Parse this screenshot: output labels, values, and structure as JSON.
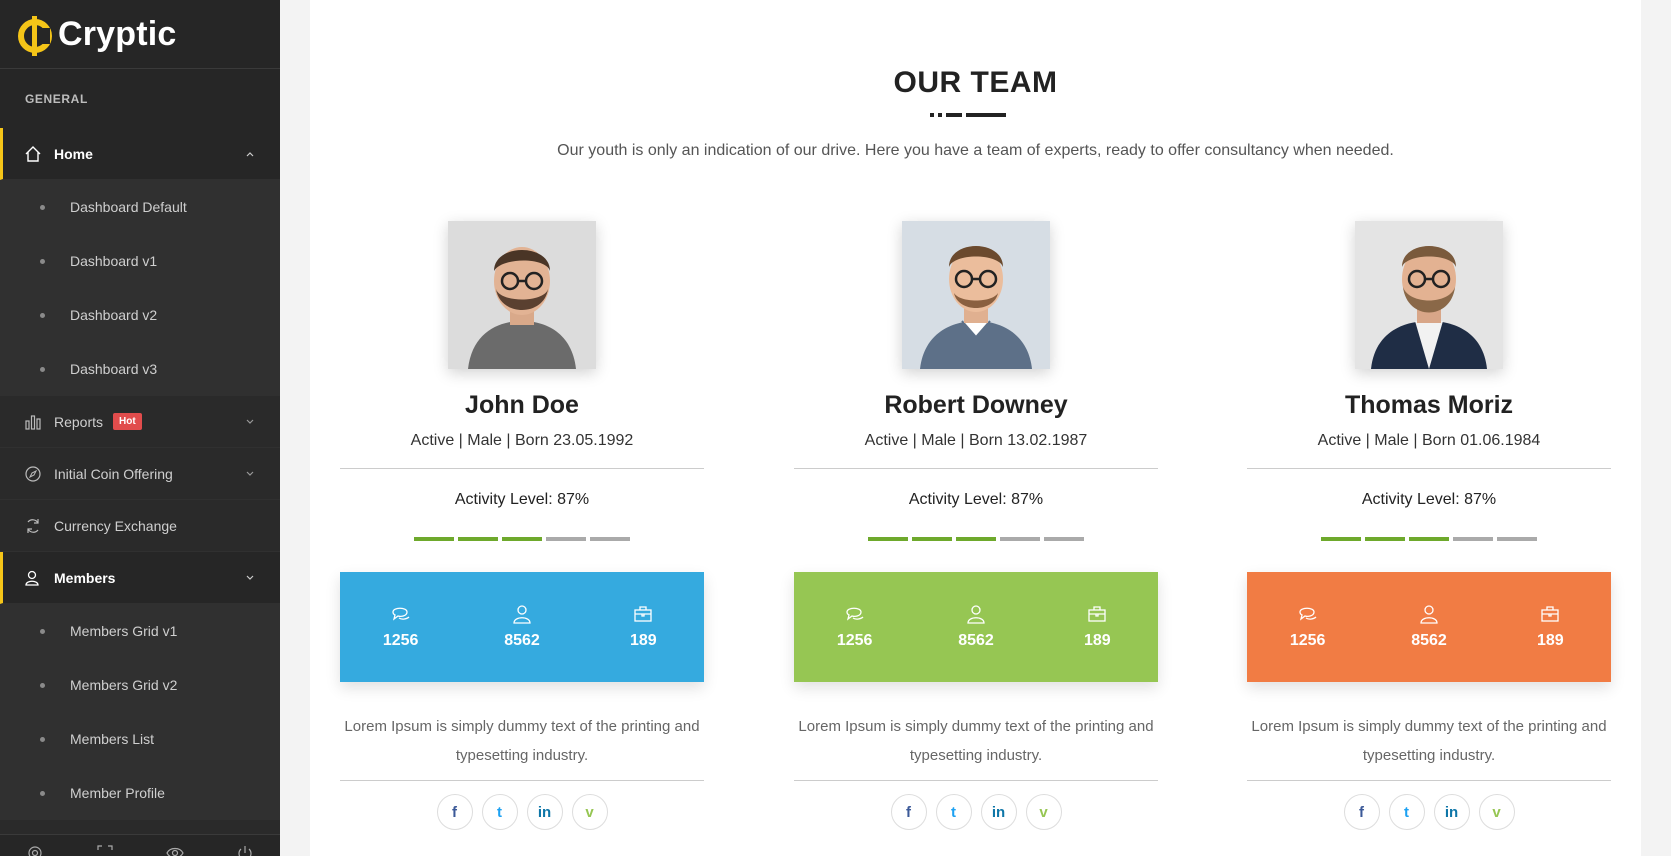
{
  "brand": {
    "name": "Cryptic",
    "accent": "#f5c518"
  },
  "sidebar": {
    "section": "GENERAL",
    "home": {
      "label": "Home",
      "icon": "home-icon"
    },
    "home_items": [
      {
        "label": "Dashboard Default"
      },
      {
        "label": "Dashboard v1"
      },
      {
        "label": "Dashboard v2"
      },
      {
        "label": "Dashboard v3"
      }
    ],
    "reports": {
      "label": "Reports",
      "badge": "Hot",
      "icon": "bar-chart-icon"
    },
    "ico": {
      "label": "Initial Coin Offering",
      "icon": "compass-icon"
    },
    "exchange": {
      "label": "Currency Exchange",
      "icon": "refresh-icon"
    },
    "members": {
      "label": "Members",
      "icon": "user-icon"
    },
    "member_items": [
      {
        "label": "Members Grid v1"
      },
      {
        "label": "Members Grid v2"
      },
      {
        "label": "Members List"
      },
      {
        "label": "Member Profile"
      }
    ],
    "footer_icons": [
      "gear-icon",
      "expand-icon",
      "eye-icon",
      "power-icon"
    ]
  },
  "main": {
    "title": "OUR TEAM",
    "subtitle": "Our youth is only an indication of our drive. Here you have a team of experts, ready to offer consultancy when needed.",
    "members": [
      {
        "name": "John Doe",
        "meta": "Active | Male | Born 23.05.1992",
        "activity": "Activity Level: 87%",
        "activity_level_segments": 3,
        "total_segments": 5,
        "color": "#35aadf",
        "stats": {
          "messages": "1256",
          "followers": "8562",
          "projects": "189"
        },
        "desc": "Lorem Ipsum is simply dummy text of the printing and typesetting industry."
      },
      {
        "name": "Robert Downey",
        "meta": "Active | Male | Born 13.02.1987",
        "activity": "Activity Level: 87%",
        "activity_level_segments": 3,
        "total_segments": 5,
        "color": "#96c653",
        "stats": {
          "messages": "1256",
          "followers": "8562",
          "projects": "189"
        },
        "desc": "Lorem Ipsum is simply dummy text of the printing and typesetting industry."
      },
      {
        "name": "Thomas Moriz",
        "meta": "Active | Male | Born 01.06.1984",
        "activity": "Activity Level: 87%",
        "activity_level_segments": 3,
        "total_segments": 5,
        "color": "#f17c44",
        "stats": {
          "messages": "1256",
          "followers": "8562",
          "projects": "189"
        },
        "desc": "Lorem Ipsum is simply dummy text of the printing and typesetting industry."
      }
    ],
    "socials": [
      {
        "icon": "facebook-icon",
        "glyph": "f",
        "color": "#3b5998"
      },
      {
        "icon": "twitter-icon",
        "glyph": "t",
        "color": "#1da1f2"
      },
      {
        "icon": "linkedin-icon",
        "glyph": "in",
        "color": "#0e76a8"
      },
      {
        "icon": "vimeo-icon",
        "glyph": "v",
        "color": "#96c653"
      }
    ]
  }
}
